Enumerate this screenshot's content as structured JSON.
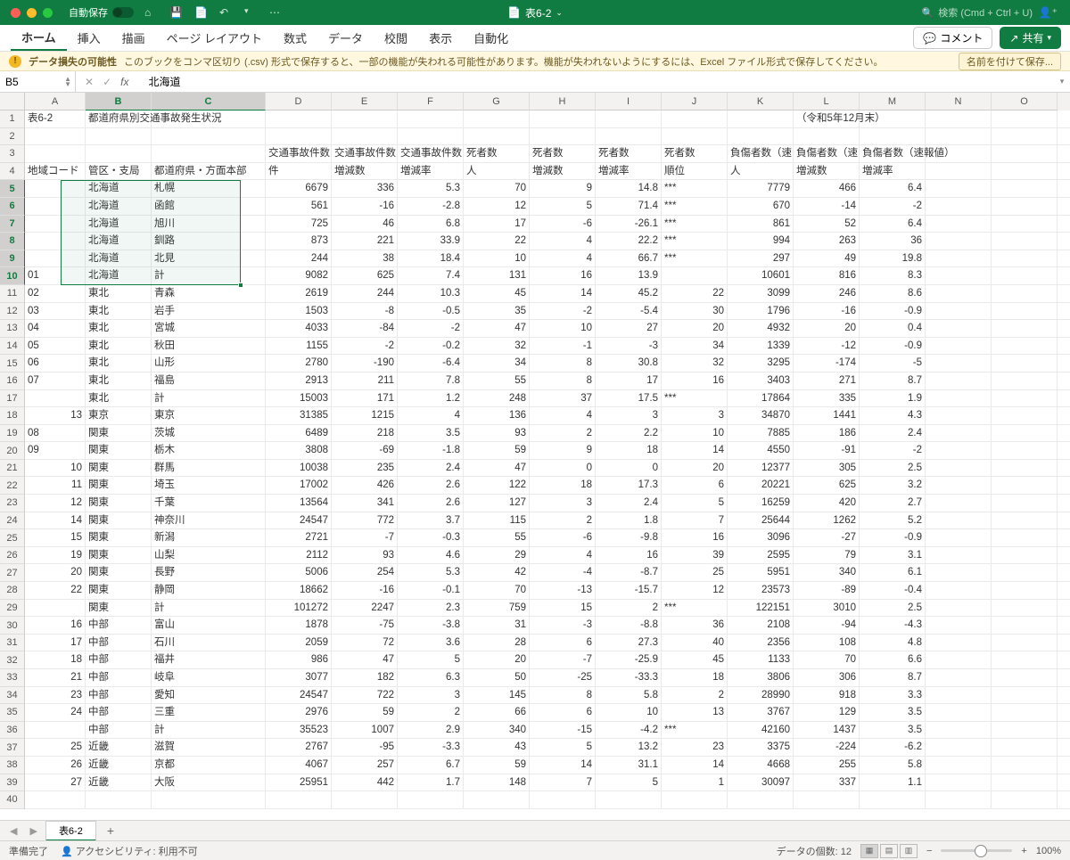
{
  "title_bar": {
    "autosave": "自動保存",
    "filename": "表6-2",
    "search_placeholder": "検索 (Cmd + Ctrl + U)"
  },
  "ribbon": {
    "tabs": [
      "ホーム",
      "挿入",
      "描画",
      "ページ レイアウト",
      "数式",
      "データ",
      "校閲",
      "表示",
      "自動化"
    ],
    "active_index": 0,
    "comment_btn": "コメント",
    "share_btn": "共有"
  },
  "warning": {
    "title": "データ損失の可能性",
    "msg": "このブックをコンマ区切り (.csv) 形式で保存すると、一部の機能が失われる可能性があります。機能が失われないようにするには、Excel ファイル形式で保存してください。",
    "btn": "名前を付けて保存..."
  },
  "formula_bar": {
    "namebox": "B5",
    "fx_label": "fx",
    "formula": "北海道"
  },
  "columns": [
    "A",
    "B",
    "C",
    "D",
    "E",
    "F",
    "G",
    "H",
    "I",
    "J",
    "K",
    "L",
    "M",
    "N",
    "O"
  ],
  "selected_cols": [
    "B",
    "C"
  ],
  "selected_rows": [
    5,
    6,
    7,
    8,
    9,
    10
  ],
  "title_row": {
    "a": "表6-2",
    "b": "都道府県別交通事故発生状況",
    "l": "（令和5年12月末）"
  },
  "header_row1": {
    "d": "交通事故件数",
    "e": "交通事故件数",
    "f": "交通事故件数",
    "g": "死者数",
    "h": "死者数",
    "i": "死者数",
    "j": "死者数",
    "k": "負傷者数（速",
    "l": "負傷者数（速",
    "m": "負傷者数（速報値）"
  },
  "header_row2": {
    "a": "地域コード",
    "b": "管区・支局",
    "c": "都道府県・方面本部",
    "d": "件",
    "e": "増減数",
    "f": "増減率",
    "g": "人",
    "h": "増減数",
    "i": "増減率",
    "j": "順位",
    "k": "人",
    "l": "増減数",
    "m": "増減率"
  },
  "data_rows": [
    {
      "a": "",
      "b": "北海道",
      "c": "札幌",
      "d": 6679,
      "e": 336,
      "f": 5.3,
      "g": 70,
      "h": 9,
      "i": 14.8,
      "j": "***",
      "k": 7779,
      "l": 466,
      "m": 6.4
    },
    {
      "a": "",
      "b": "北海道",
      "c": "函館",
      "d": 561,
      "e": -16,
      "f": -2.8,
      "g": 12,
      "h": 5,
      "i": 71.4,
      "j": "***",
      "k": 670,
      "l": -14,
      "m": -2
    },
    {
      "a": "",
      "b": "北海道",
      "c": "旭川",
      "d": 725,
      "e": 46,
      "f": 6.8,
      "g": 17,
      "h": -6,
      "i": -26.1,
      "j": "***",
      "k": 861,
      "l": 52,
      "m": 6.4
    },
    {
      "a": "",
      "b": "北海道",
      "c": "釧路",
      "d": 873,
      "e": 221,
      "f": 33.9,
      "g": 22,
      "h": 4,
      "i": 22.2,
      "j": "***",
      "k": 994,
      "l": 263,
      "m": 36
    },
    {
      "a": "",
      "b": "北海道",
      "c": "北見",
      "d": 244,
      "e": 38,
      "f": 18.4,
      "g": 10,
      "h": 4,
      "i": 66.7,
      "j": "***",
      "k": 297,
      "l": 49,
      "m": 19.8
    },
    {
      "a": "01",
      "b": "北海道",
      "c": "計",
      "d": 9082,
      "e": 625,
      "f": 7.4,
      "g": 131,
      "h": 16,
      "i": 13.9,
      "j": "",
      "k": 10601,
      "l": 816,
      "m": 8.3
    },
    {
      "a": "02",
      "b": "東北",
      "c": "青森",
      "d": 2619,
      "e": 244,
      "f": 10.3,
      "g": 45,
      "h": 14,
      "i": 45.2,
      "j": 22,
      "k": 3099,
      "l": 246,
      "m": 8.6
    },
    {
      "a": "03",
      "b": "東北",
      "c": "岩手",
      "d": 1503,
      "e": -8,
      "f": -0.5,
      "g": 35,
      "h": -2,
      "i": -5.4,
      "j": 30,
      "k": 1796,
      "l": -16,
      "m": -0.9
    },
    {
      "a": "04",
      "b": "東北",
      "c": "宮城",
      "d": 4033,
      "e": -84,
      "f": -2,
      "g": 47,
      "h": 10,
      "i": 27,
      "j": 20,
      "k": 4932,
      "l": 20,
      "m": 0.4
    },
    {
      "a": "05",
      "b": "東北",
      "c": "秋田",
      "d": 1155,
      "e": -2,
      "f": -0.2,
      "g": 32,
      "h": -1,
      "i": -3,
      "j": 34,
      "k": 1339,
      "l": -12,
      "m": -0.9
    },
    {
      "a": "06",
      "b": "東北",
      "c": "山形",
      "d": 2780,
      "e": -190,
      "f": -6.4,
      "g": 34,
      "h": 8,
      "i": 30.8,
      "j": 32,
      "k": 3295,
      "l": -174,
      "m": -5
    },
    {
      "a": "07",
      "b": "東北",
      "c": "福島",
      "d": 2913,
      "e": 211,
      "f": 7.8,
      "g": 55,
      "h": 8,
      "i": 17,
      "j": 16,
      "k": 3403,
      "l": 271,
      "m": 8.7
    },
    {
      "a": "",
      "b": "東北",
      "c": "計",
      "d": 15003,
      "e": 171,
      "f": 1.2,
      "g": 248,
      "h": 37,
      "i": 17.5,
      "j": "***",
      "k": 17864,
      "l": 335,
      "m": 1.9
    },
    {
      "a": 13,
      "b": "東京",
      "c": "東京",
      "d": 31385,
      "e": 1215,
      "f": 4,
      "g": 136,
      "h": 4,
      "i": 3,
      "j": 3,
      "k": 34870,
      "l": 1441,
      "m": 4.3
    },
    {
      "a": "08",
      "b": "関東",
      "c": "茨城",
      "d": 6489,
      "e": 218,
      "f": 3.5,
      "g": 93,
      "h": 2,
      "i": 2.2,
      "j": 10,
      "k": 7885,
      "l": 186,
      "m": 2.4
    },
    {
      "a": "09",
      "b": "関東",
      "c": "栃木",
      "d": 3808,
      "e": -69,
      "f": -1.8,
      "g": 59,
      "h": 9,
      "i": 18,
      "j": 14,
      "k": 4550,
      "l": -91,
      "m": -2
    },
    {
      "a": 10,
      "b": "関東",
      "c": "群馬",
      "d": 10038,
      "e": 235,
      "f": 2.4,
      "g": 47,
      "h": 0,
      "i": 0,
      "j": 20,
      "k": 12377,
      "l": 305,
      "m": 2.5
    },
    {
      "a": 11,
      "b": "関東",
      "c": "埼玉",
      "d": 17002,
      "e": 426,
      "f": 2.6,
      "g": 122,
      "h": 18,
      "i": 17.3,
      "j": 6,
      "k": 20221,
      "l": 625,
      "m": 3.2
    },
    {
      "a": 12,
      "b": "関東",
      "c": "千葉",
      "d": 13564,
      "e": 341,
      "f": 2.6,
      "g": 127,
      "h": 3,
      "i": 2.4,
      "j": 5,
      "k": 16259,
      "l": 420,
      "m": 2.7
    },
    {
      "a": 14,
      "b": "関東",
      "c": "神奈川",
      "d": 24547,
      "e": 772,
      "f": 3.7,
      "g": 115,
      "h": 2,
      "i": 1.8,
      "j": 7,
      "k": 25644,
      "l": 1262,
      "m": 5.2
    },
    {
      "a": 15,
      "b": "関東",
      "c": "新潟",
      "d": 2721,
      "e": -7,
      "f": -0.3,
      "g": 55,
      "h": -6,
      "i": -9.8,
      "j": 16,
      "k": 3096,
      "l": -27,
      "m": -0.9
    },
    {
      "a": 19,
      "b": "関東",
      "c": "山梨",
      "d": 2112,
      "e": 93,
      "f": 4.6,
      "g": 29,
      "h": 4,
      "i": 16,
      "j": 39,
      "k": 2595,
      "l": 79,
      "m": 3.1
    },
    {
      "a": 20,
      "b": "関東",
      "c": "長野",
      "d": 5006,
      "e": 254,
      "f": 5.3,
      "g": 42,
      "h": -4,
      "i": -8.7,
      "j": 25,
      "k": 5951,
      "l": 340,
      "m": 6.1
    },
    {
      "a": 22,
      "b": "関東",
      "c": "静岡",
      "d": 18662,
      "e": -16,
      "f": -0.1,
      "g": 70,
      "h": -13,
      "i": -15.7,
      "j": 12,
      "k": 23573,
      "l": -89,
      "m": -0.4
    },
    {
      "a": "",
      "b": "関東",
      "c": "計",
      "d": 101272,
      "e": 2247,
      "f": 2.3,
      "g": 759,
      "h": 15,
      "i": 2,
      "j": "***",
      "k": 122151,
      "l": 3010,
      "m": 2.5
    },
    {
      "a": 16,
      "b": "中部",
      "c": "富山",
      "d": 1878,
      "e": -75,
      "f": -3.8,
      "g": 31,
      "h": -3,
      "i": -8.8,
      "j": 36,
      "k": 2108,
      "l": -94,
      "m": -4.3
    },
    {
      "a": 17,
      "b": "中部",
      "c": "石川",
      "d": 2059,
      "e": 72,
      "f": 3.6,
      "g": 28,
      "h": 6,
      "i": 27.3,
      "j": 40,
      "k": 2356,
      "l": 108,
      "m": 4.8
    },
    {
      "a": 18,
      "b": "中部",
      "c": "福井",
      "d": 986,
      "e": 47,
      "f": 5,
      "g": 20,
      "h": -7,
      "i": -25.9,
      "j": 45,
      "k": 1133,
      "l": 70,
      "m": 6.6
    },
    {
      "a": 21,
      "b": "中部",
      "c": "岐阜",
      "d": 3077,
      "e": 182,
      "f": 6.3,
      "g": 50,
      "h": -25,
      "i": -33.3,
      "j": 18,
      "k": 3806,
      "l": 306,
      "m": 8.7
    },
    {
      "a": 23,
      "b": "中部",
      "c": "愛知",
      "d": 24547,
      "e": 722,
      "f": 3,
      "g": 145,
      "h": 8,
      "i": 5.8,
      "j": 2,
      "k": 28990,
      "l": 918,
      "m": 3.3
    },
    {
      "a": 24,
      "b": "中部",
      "c": "三重",
      "d": 2976,
      "e": 59,
      "f": 2,
      "g": 66,
      "h": 6,
      "i": 10,
      "j": 13,
      "k": 3767,
      "l": 129,
      "m": 3.5
    },
    {
      "a": "",
      "b": "中部",
      "c": "計",
      "d": 35523,
      "e": 1007,
      "f": 2.9,
      "g": 340,
      "h": -15,
      "i": -4.2,
      "j": "***",
      "k": 42160,
      "l": 1437,
      "m": 3.5
    },
    {
      "a": 25,
      "b": "近畿",
      "c": "滋賀",
      "d": 2767,
      "e": -95,
      "f": -3.3,
      "g": 43,
      "h": 5,
      "i": 13.2,
      "j": 23,
      "k": 3375,
      "l": -224,
      "m": -6.2
    },
    {
      "a": 26,
      "b": "近畿",
      "c": "京都",
      "d": 4067,
      "e": 257,
      "f": 6.7,
      "g": 59,
      "h": 14,
      "i": 31.1,
      "j": 14,
      "k": 4668,
      "l": 255,
      "m": 5.8
    },
    {
      "a": 27,
      "b": "近畿",
      "c": "大阪",
      "d": 25951,
      "e": 442,
      "f": 1.7,
      "g": 148,
      "h": 7,
      "i": 5,
      "j": 1,
      "k": 30097,
      "l": 337,
      "m": 1.1
    }
  ],
  "sheet_tabs": {
    "active": "表6-2"
  },
  "status": {
    "ready": "準備完了",
    "access": "アクセシビリティ: 利用不可",
    "count": "データの個数: 12",
    "zoom": "100%"
  }
}
